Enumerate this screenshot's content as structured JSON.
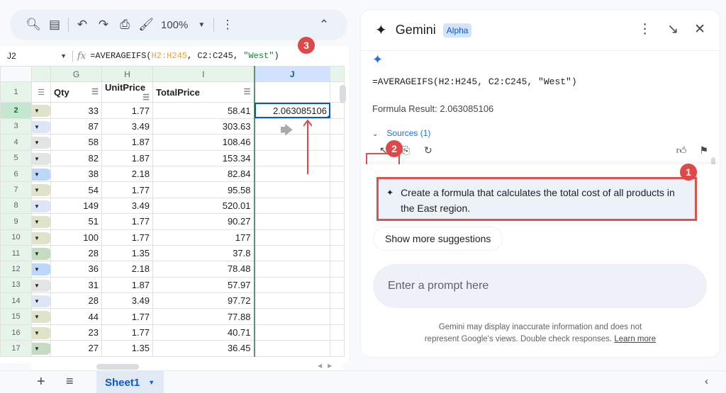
{
  "toolbar": {
    "zoom_level": "100%",
    "icons": [
      "search-icon",
      "menus-icon",
      "undo-icon",
      "redo-icon",
      "print-icon",
      "paint-format-icon",
      "more-vert-icon",
      "collapse-icon"
    ]
  },
  "formula_bar": {
    "cell_ref": "J2",
    "fx_label": "fx",
    "formula_prefix": "=AVERAGEIFS(",
    "formula_range1": "H2:H245",
    "formula_sep1": ", ",
    "formula_range2": "C2:C245",
    "formula_sep2": ", ",
    "formula_string": "\"West\"",
    "formula_suffix": ")"
  },
  "grid": {
    "columns": [
      "",
      "G",
      "H",
      "I",
      "J"
    ],
    "selected_column": "J",
    "selected_cell": "J2",
    "header_row": {
      "row": "1",
      "qty": "Qty",
      "unit_price": "UnitPrice",
      "total_price": "TotalPrice",
      "j": ""
    },
    "rows": [
      {
        "row": "2",
        "chip": "#dfe3c9",
        "qty": "33",
        "unit_price": "1.77",
        "total_price": "58.41",
        "j": "2.063085106"
      },
      {
        "row": "3",
        "chip": "#dde6f7",
        "qty": "87",
        "unit_price": "3.49",
        "total_price": "303.63",
        "j": ""
      },
      {
        "row": "4",
        "chip": "#e1e6e3",
        "qty": "58",
        "unit_price": "1.87",
        "total_price": "108.46",
        "j": ""
      },
      {
        "row": "5",
        "chip": "#e1e6e3",
        "qty": "82",
        "unit_price": "1.87",
        "total_price": "153.34",
        "j": ""
      },
      {
        "row": "6",
        "chip": "#bcd7f7",
        "qty": "38",
        "unit_price": "2.18",
        "total_price": "82.84",
        "j": ""
      },
      {
        "row": "7",
        "chip": "#dfe3c9",
        "qty": "54",
        "unit_price": "1.77",
        "total_price": "95.58",
        "j": ""
      },
      {
        "row": "8",
        "chip": "#dde6f7",
        "qty": "149",
        "unit_price": "3.49",
        "total_price": "520.01",
        "j": ""
      },
      {
        "row": "9",
        "chip": "#dfe3c9",
        "qty": "51",
        "unit_price": "1.77",
        "total_price": "90.27",
        "j": ""
      },
      {
        "row": "10",
        "chip": "#dfe3c9",
        "qty": "100",
        "unit_price": "1.77",
        "total_price": "177",
        "j": ""
      },
      {
        "row": "11",
        "chip": "#c5dcc2",
        "qty": "28",
        "unit_price": "1.35",
        "total_price": "37.8",
        "j": ""
      },
      {
        "row": "12",
        "chip": "#bcd7f7",
        "qty": "36",
        "unit_price": "2.18",
        "total_price": "78.48",
        "j": ""
      },
      {
        "row": "13",
        "chip": "#e1e6e3",
        "qty": "31",
        "unit_price": "1.87",
        "total_price": "57.97",
        "j": ""
      },
      {
        "row": "14",
        "chip": "#dde6f7",
        "qty": "28",
        "unit_price": "3.49",
        "total_price": "97.72",
        "j": ""
      },
      {
        "row": "15",
        "chip": "#dfe3c9",
        "qty": "44",
        "unit_price": "1.77",
        "total_price": "77.88",
        "j": ""
      },
      {
        "row": "16",
        "chip": "#dfe3c9",
        "qty": "23",
        "unit_price": "1.77",
        "total_price": "40.71",
        "j": ""
      },
      {
        "row": "17",
        "chip": "#c5dcc2",
        "qty": "27",
        "unit_price": "1.35",
        "total_price": "36.45",
        "j": ""
      }
    ]
  },
  "sheet_tabs": {
    "active": "Sheet1",
    "add_icon": "+",
    "list_icon": "≡"
  },
  "gemini": {
    "title": "Gemini",
    "badge": "Alpha",
    "response_formula": "=AVERAGEIFS(H2:H245, C2:C245, \"West\")",
    "formula_result": "Formula Result: 2.063085106",
    "sources": "Sources (1)",
    "suggestion": "Create a formula that calculates the total cost of all products in the East region.",
    "more_suggestions": "Show more suggestions",
    "prompt_placeholder": "Enter a prompt here",
    "disclaimer_line1": "Gemini may display inaccurate information and does not",
    "disclaimer_line2": "represent Google's views. Double check responses.",
    "learn_more": "Learn more"
  },
  "annotations": {
    "badge1": "1",
    "badge2": "2",
    "badge3": "3",
    "highlight_color": "#d9534f"
  }
}
